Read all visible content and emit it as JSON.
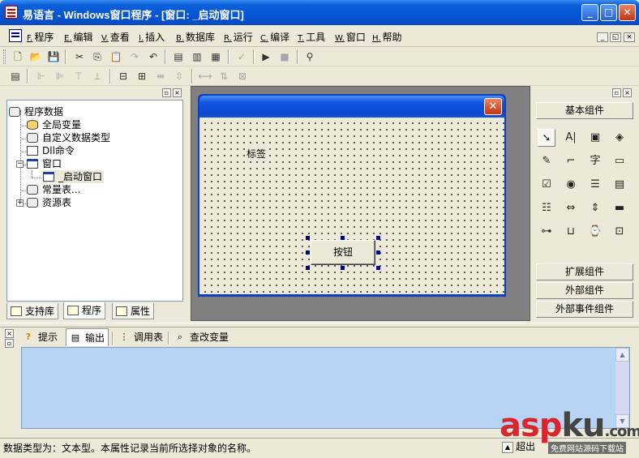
{
  "window": {
    "title": "易语言 - Windows窗口程序 - [窗口: _启动窗口]",
    "min_glyph": "_",
    "max_glyph": "□",
    "close_glyph": "✕"
  },
  "menu": {
    "items": [
      {
        "key": "F.",
        "label": "程序"
      },
      {
        "key": "E.",
        "label": "编辑"
      },
      {
        "key": "V.",
        "label": "查看"
      },
      {
        "key": "I.",
        "label": "插入"
      },
      {
        "key": "B.",
        "label": "数据库"
      },
      {
        "key": "R.",
        "label": "运行"
      },
      {
        "key": "C.",
        "label": "编译"
      },
      {
        "key": "T.",
        "label": "工具"
      },
      {
        "key": "W.",
        "label": "窗口"
      },
      {
        "key": "H.",
        "label": "帮助"
      }
    ],
    "mdi_min": "_",
    "mdi_restore": "◱",
    "mdi_close": "×"
  },
  "toolbar": {
    "icons": [
      "new-file-icon",
      "open-folder-icon",
      "save-icon",
      "cut-icon",
      "copy-icon",
      "paste-icon",
      "redo-icon",
      "undo-icon",
      "window-layout-1-icon",
      "window-layout-2-icon",
      "window-layout-3-icon",
      "check-icon",
      "run-icon",
      "stop-icon",
      "debug-icon"
    ]
  },
  "tree": {
    "root": "程序数据",
    "items": [
      {
        "label": "全局变量"
      },
      {
        "label": "自定义数据类型"
      },
      {
        "label": "Dll命令"
      },
      {
        "label": "窗口",
        "expander": "−"
      },
      {
        "label": "_启动窗口"
      },
      {
        "label": "常量表..."
      },
      {
        "label": "资源表",
        "expander": "+"
      }
    ]
  },
  "left_tabs": [
    {
      "label": "支持库"
    },
    {
      "label": "程序"
    },
    {
      "label": "属性"
    }
  ],
  "form": {
    "close_glyph": "✕",
    "label_text": "标签",
    "button_text": "按钮"
  },
  "components": {
    "basic": "基本组件",
    "extended": "扩展组件",
    "external": "外部组件",
    "external_events": "外部事件组件",
    "grid": [
      {
        "name": "pointer-tool-icon",
        "glyph": "➘"
      },
      {
        "name": "label-tool-icon",
        "glyph": "A|"
      },
      {
        "name": "picture-tool-icon",
        "glyph": "▣"
      },
      {
        "name": "shape-tool-icon",
        "glyph": "◈"
      },
      {
        "name": "edit-tool-icon",
        "glyph": "✎"
      },
      {
        "name": "groupbox-tool-icon",
        "glyph": "⌐"
      },
      {
        "name": "text-tool-icon",
        "glyph": "字"
      },
      {
        "name": "button-tool-icon",
        "glyph": "▭"
      },
      {
        "name": "checkbox-tool-icon",
        "glyph": "☑"
      },
      {
        "name": "radio-tool-icon",
        "glyph": "◉"
      },
      {
        "name": "combobox-tool-icon",
        "glyph": "☰"
      },
      {
        "name": "listbox-tool-icon",
        "glyph": "▤"
      },
      {
        "name": "selectlist-tool-icon",
        "glyph": "☷"
      },
      {
        "name": "hscroll-tool-icon",
        "glyph": "⇔"
      },
      {
        "name": "vscroll-tool-icon",
        "glyph": "⇕"
      },
      {
        "name": "progress-tool-icon",
        "glyph": "▬"
      },
      {
        "name": "slider-tool-icon",
        "glyph": "⊶"
      },
      {
        "name": "tab-tool-icon",
        "glyph": "⊔"
      },
      {
        "name": "timer-tool-icon",
        "glyph": "⌚"
      },
      {
        "name": "dialog-tool-icon",
        "glyph": "⊡"
      }
    ]
  },
  "bottom_tabs": [
    {
      "label": "提示",
      "glyph": "?"
    },
    {
      "label": "输出",
      "glyph": "▤"
    },
    {
      "label": "调用表",
      "glyph": "⋮"
    },
    {
      "label": "查改变量",
      "glyph": "⌕"
    }
  ],
  "status": {
    "text": "数据类型为：文本型。本属性记录当前所选择对象的名称。",
    "overtype": "超出"
  },
  "watermark": {
    "main_a": "asp",
    "main_b": "ku",
    "main_c": ".com",
    "sub": "免费网站源码下载站"
  }
}
